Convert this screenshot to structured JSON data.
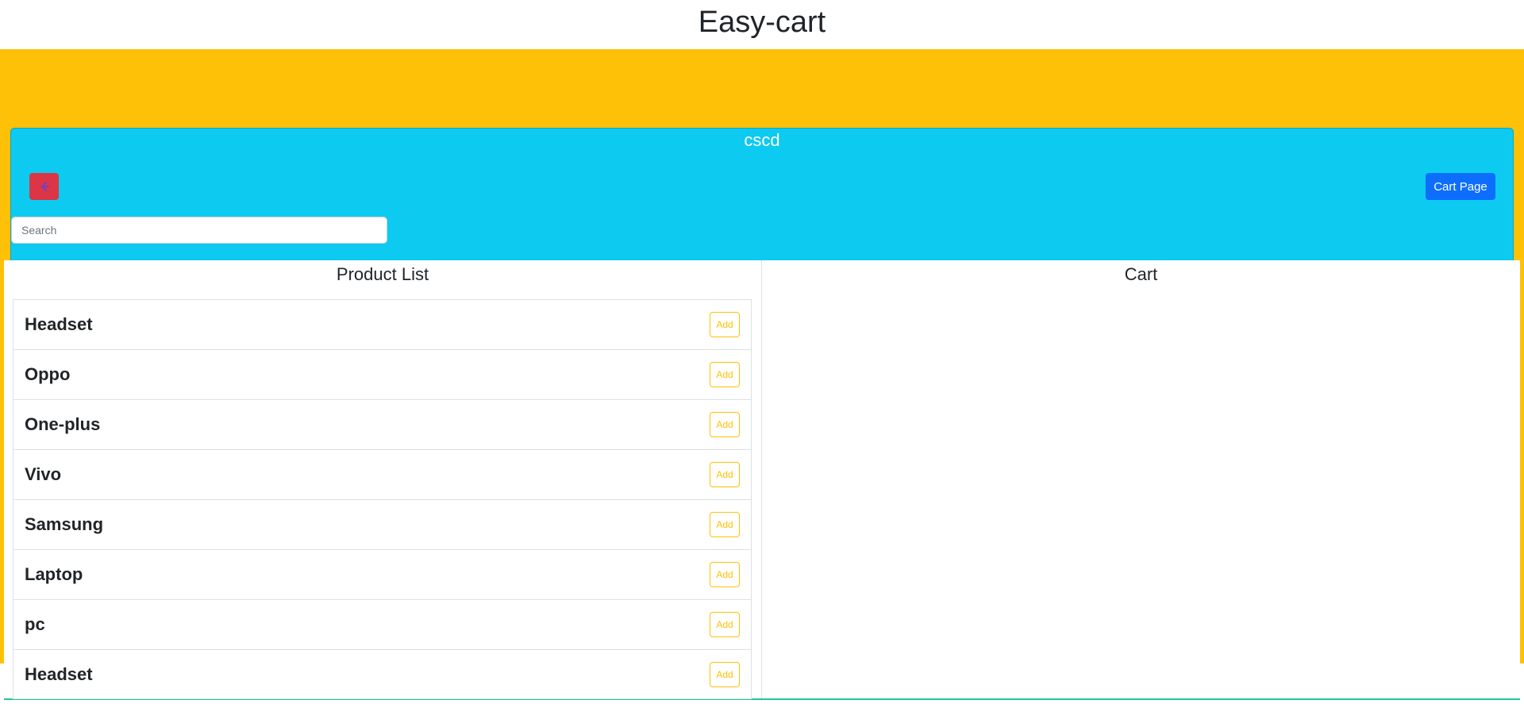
{
  "app": {
    "title": "Easy-cart"
  },
  "header": {
    "user_name": "cscd",
    "back_icon": "arrow-left-icon",
    "cart_button_label": "Cart Page",
    "search_placeholder": "Search",
    "search_value": ""
  },
  "product_list": {
    "title": "Product List",
    "add_label": "Add",
    "items": [
      {
        "name": "Headset"
      },
      {
        "name": "Oppo"
      },
      {
        "name": "One-plus"
      },
      {
        "name": "Vivo"
      },
      {
        "name": "Samsung"
      },
      {
        "name": "Laptop"
      },
      {
        "name": "pc"
      },
      {
        "name": "Headset"
      }
    ]
  },
  "cart": {
    "title": "Cart",
    "items": []
  },
  "colors": {
    "band": "#ffc107",
    "header": "#0dcaf0",
    "back_button": "#dc3545",
    "cart_button": "#0d6efd",
    "add_button": "#ffc107"
  }
}
